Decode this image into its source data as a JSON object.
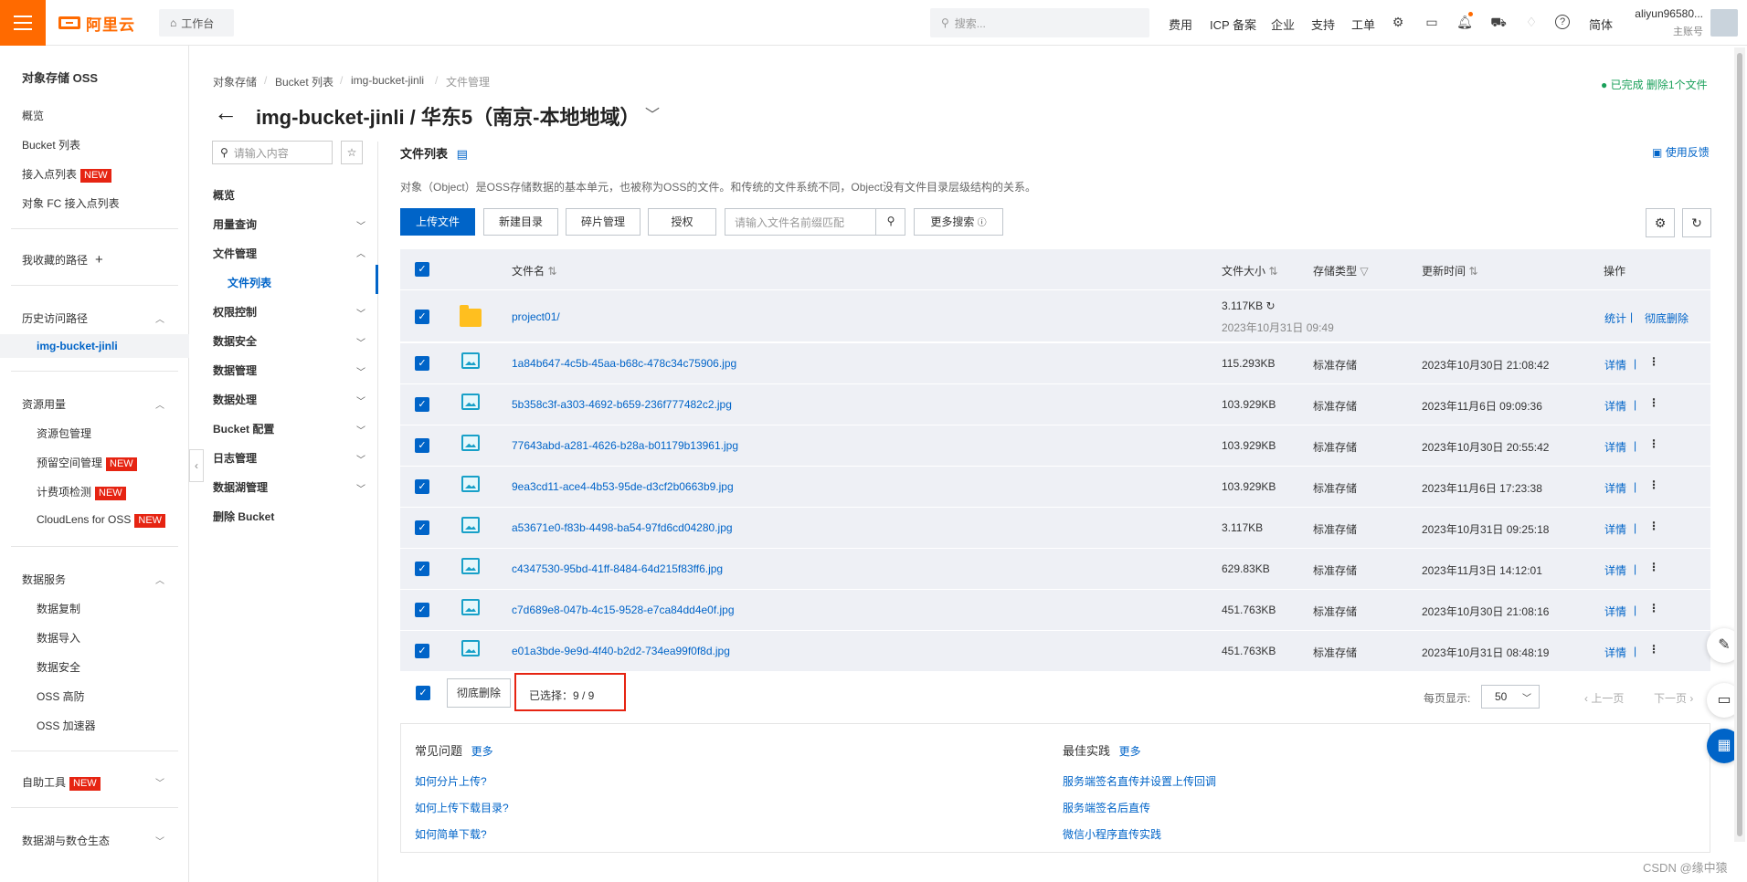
{
  "topbar": {
    "brand": "阿里云",
    "workbench": "工作台",
    "search_placeholder": "搜索...",
    "nav": [
      "费用",
      "ICP 备案",
      "企业",
      "支持",
      "工单"
    ],
    "lang": "简体",
    "user_name": "aliyun96580...",
    "user_role": "主账号"
  },
  "sidebar": {
    "title": "对象存储 OSS",
    "items": [
      "概览",
      "Bucket 列表",
      "接入点列表",
      "对象 FC 接入点列表"
    ],
    "favorites": "我收藏的路径",
    "history_title": "历史访问路径",
    "history_active": "img-bucket-jinli",
    "resource_title": "资源用量",
    "resource_items": [
      "资源包管理",
      "预留空间管理",
      "计费项检测",
      "CloudLens for OSS"
    ],
    "data_services_title": "数据服务",
    "data_services_items": [
      "数据复制",
      "数据导入",
      "数据安全",
      "OSS 高防",
      "OSS 加速器"
    ],
    "tools": "自助工具",
    "datalake": "数据湖与数仓生态",
    "new_badge": "NEW"
  },
  "breadcrumb": [
    "对象存储",
    "Bucket 列表",
    "img-bucket-jinli",
    "文件管理"
  ],
  "page": {
    "title": "img-bucket-jinli / 华东5（南京-本地地域）",
    "status": "已完成 删除1个文件"
  },
  "subnav": {
    "search_placeholder": "请输入内容",
    "items": [
      "概览",
      "用量查询",
      "文件管理",
      "文件列表",
      "权限控制",
      "数据安全",
      "数据管理",
      "数据处理",
      "Bucket 配置",
      "日志管理",
      "数据湖管理",
      "删除 Bucket"
    ]
  },
  "content": {
    "list_title": "文件列表",
    "feedback": "使用反馈",
    "description": "对象（Object）是OSS存储数据的基本单元，也被称为OSS的文件。和传统的文件系统不同，Object没有文件目录层级结构的关系。",
    "buttons": {
      "upload": "上传文件",
      "new_dir": "新建目录",
      "fragments": "碎片管理",
      "authorize": "授权",
      "more_search": "更多搜索"
    },
    "file_search_placeholder": "请输入文件名前缀匹配"
  },
  "table": {
    "headers": {
      "name": "文件名",
      "size": "文件大小",
      "storage": "存储类型",
      "updated": "更新时间",
      "actions": "操作"
    },
    "folder": {
      "name": "project01/",
      "size": "3.117KB",
      "date": "2023年10月31日 09:49",
      "action1": "统计",
      "action2": "彻底删除"
    },
    "rows": [
      {
        "name": "1a84b647-4c5b-45aa-b68c-478c34c75906.jpg",
        "size": "115.293KB",
        "storage": "标准存储",
        "updated": "2023年10月30日 21:08:42",
        "action": "详情"
      },
      {
        "name": "5b358c3f-a303-4692-b659-236f777482c2.jpg",
        "size": "103.929KB",
        "storage": "标准存储",
        "updated": "2023年11月6日 09:09:36",
        "action": "详情"
      },
      {
        "name": "77643abd-a281-4626-b28a-b01179b13961.jpg",
        "size": "103.929KB",
        "storage": "标准存储",
        "updated": "2023年10月30日 20:55:42",
        "action": "详情"
      },
      {
        "name": "9ea3cd11-ace4-4b53-95de-d3cf2b0663b9.jpg",
        "size": "103.929KB",
        "storage": "标准存储",
        "updated": "2023年11月6日 17:23:38",
        "action": "详情"
      },
      {
        "name": "a53671e0-f83b-4498-ba54-97fd6cd04280.jpg",
        "size": "3.117KB",
        "storage": "标准存储",
        "updated": "2023年10月31日 09:25:18",
        "action": "详情"
      },
      {
        "name": "c4347530-95bd-41ff-8484-64d215f83ff6.jpg",
        "size": "629.83KB",
        "storage": "标准存储",
        "updated": "2023年11月3日 14:12:01",
        "action": "详情"
      },
      {
        "name": "c7d689e8-047b-4c15-9528-e7ca84dd4e0f.jpg",
        "size": "451.763KB",
        "storage": "标准存储",
        "updated": "2023年10月30日 21:08:16",
        "action": "详情"
      },
      {
        "name": "e01a3bde-9e9d-4f40-b2d2-734ea99f0f8d.jpg",
        "size": "451.763KB",
        "storage": "标准存储",
        "updated": "2023年10月31日 08:48:19",
        "action": "详情"
      }
    ]
  },
  "footer": {
    "bulk_delete": "彻底删除",
    "selected": "已选择：9 / 9",
    "per_page_label": "每页显示:",
    "per_page": "50",
    "prev": "上一页",
    "next": "下一页"
  },
  "faq": {
    "common_title": "常见问题",
    "more": "更多",
    "common": [
      "如何分片上传?",
      "如何上传下载目录?",
      "如何简单下载?"
    ],
    "best_title": "最佳实践",
    "best": [
      "服务端签名直传并设置上传回调",
      "服务端签名后直传",
      "微信小程序直传实践"
    ]
  },
  "watermark": "CSDN @缘中猿",
  "colors": {
    "brand": "#ff6a00",
    "primary": "#0064c8",
    "success": "#1aa05a",
    "danger": "#e62412"
  }
}
